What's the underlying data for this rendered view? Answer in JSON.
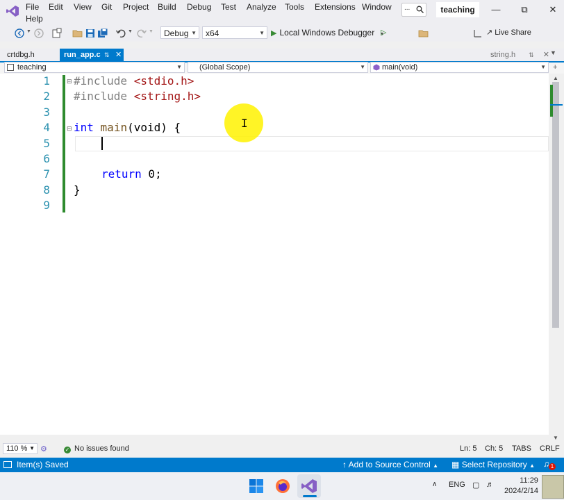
{
  "menu": [
    "File",
    "Edit",
    "View",
    "Git",
    "Project",
    "Build",
    "Debug",
    "Test",
    "Analyze",
    "Tools",
    "Extensions",
    "Window",
    "Help"
  ],
  "search_label": "...",
  "solution_name": "teaching",
  "toolbar": {
    "config": "Debug",
    "platform": "x64",
    "debugger": "Local Windows Debugger",
    "live_share": "Live Share"
  },
  "tabs": {
    "crtdbg": "crtdbg.h",
    "active": "run_app.c",
    "string": "string.h"
  },
  "nav": {
    "project": "teaching",
    "scope": "(Global Scope)",
    "member": "main(void)"
  },
  "editor": {
    "line_numbers": [
      "1",
      "2",
      "3",
      "4",
      "5",
      "6",
      "7",
      "8",
      "9"
    ],
    "include_kw": "#include",
    "include1": "<stdio.h>",
    "include2": "<string.h>",
    "int_kw": "int",
    "main_fn": "main",
    "main_args": "(void) {",
    "return_kw": "return",
    "return_val": " 0;",
    "close_brace": "}"
  },
  "infobar": {
    "zoom": "110 %",
    "issues": "No issues found",
    "ln": "Ln: 5",
    "ch": "Ch: 5",
    "tabs": "TABS",
    "eol": "CRLF"
  },
  "statusbar": {
    "message": "Item(s) Saved",
    "source_control": "Add to Source Control",
    "repository": "Select Repository",
    "notification_count": "1"
  },
  "taskbar": {
    "lang": "ENG",
    "time": "11:29",
    "date": "2024/2/14"
  },
  "colors": {
    "accent": "#007acc",
    "change_bar": "#2e8b2e",
    "cursor_highlight": "#fff200"
  }
}
